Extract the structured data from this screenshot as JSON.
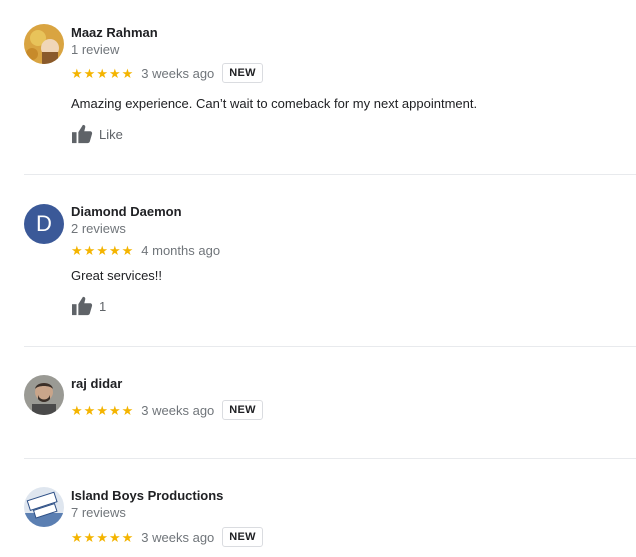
{
  "reviews": [
    {
      "name": "Maaz Rahman",
      "count": "1 review",
      "stars": 5,
      "when": "3 weeks ago",
      "badge": "NEW",
      "text": "Amazing experience. Can’t wait to comeback for my next appointment.",
      "like_label": "Like",
      "avatar_icon": "photo-avatar"
    },
    {
      "name": "Diamond Daemon",
      "count": "2 reviews",
      "stars": 5,
      "when": "4 months ago",
      "text": "Great services!!",
      "like_label": "1",
      "avatar_letter": "D",
      "avatar_color": "#3b5998"
    },
    {
      "name": "raj didar",
      "stars": 5,
      "when": "3 weeks ago",
      "badge": "NEW",
      "avatar_icon": "photo-avatar"
    },
    {
      "name": "Island Boys Productions",
      "count": "7 reviews",
      "stars": 5,
      "when": "3 weeks ago",
      "badge": "NEW",
      "avatar_icon": "logo-avatar"
    }
  ],
  "colors": {
    "star": "#f4b400",
    "secondary_text": "#70757a",
    "divider": "#e8eaed"
  }
}
